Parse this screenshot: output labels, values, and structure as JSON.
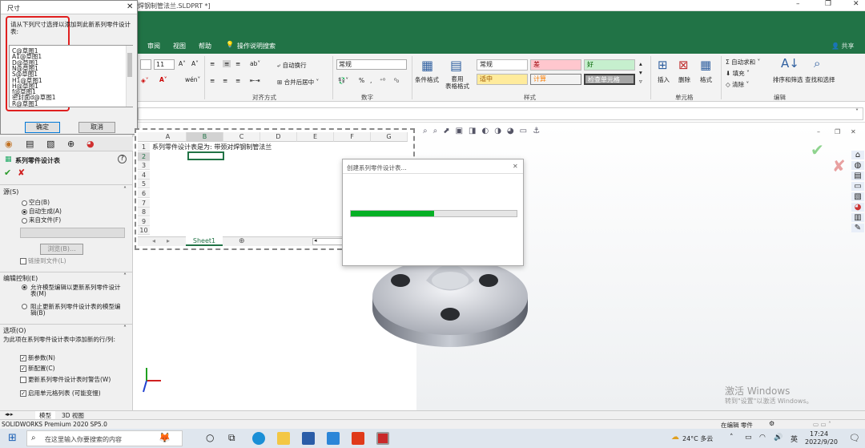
{
  "window": {
    "title": "法兰对焊钢制管法兰.SLDPRT *]",
    "title_display": "焊钢制管法兰.SLDPRT *]",
    "minimize": "–",
    "restore": "❐",
    "close": "✕"
  },
  "ribbon_tabs": [
    "审阅",
    "视图",
    "帮助",
    "操作说明搜索"
  ],
  "share_label": "共享",
  "ribbon": {
    "font_size": "11",
    "font_grow": "A˄",
    "font_shrink": "A˅",
    "wrap_text": "自动换行",
    "merge_center": "合并后居中",
    "number_format": "常规",
    "percent": "%",
    "comma": ",",
    "cond_format": "条件格式",
    "table_format": "套用\n表格格式",
    "styles": {
      "normal": "常规",
      "bad": "差",
      "good": "好",
      "neutral": "适中",
      "calc": "计算",
      "check": "检查单元格"
    },
    "insert": "插入",
    "delete": "删除",
    "format": "格式",
    "autosum": "自动求和",
    "fill": "填充",
    "clear": "清除",
    "sort_filter": "排序和筛选",
    "find_select": "查找和选择",
    "groups": {
      "alignment": "对齐方式",
      "number": "数字",
      "styles": "样式",
      "cells": "单元格",
      "editing": "编辑"
    }
  },
  "dimension_dialog": {
    "title": "尺寸",
    "prompt": "请从下列尺寸选择以添加到此新系列零件设计表:",
    "items": [
      "C@草图1",
      "A1@草图1",
      "D@草图1",
      "N@草图1",
      "S@草图1",
      "H1@草图1",
      "H@草图1",
      "f@草图1",
      "密封面d@草图1",
      "R@草图1"
    ],
    "ok": "确定",
    "cancel": "取消"
  },
  "property_panel": {
    "title": "系列零件设计表",
    "help": "?",
    "source_section": "源(S)",
    "source_options": [
      "空白(B)",
      "自动生成(A)",
      "来自文件(F)"
    ],
    "source_selected": 1,
    "browse": "浏览(B)...",
    "link_file": "链接到文件(L)",
    "edit_section": "编辑控制(E)",
    "edit_options": [
      "允许模型编辑以更新系列零件设计表(M)",
      "阻止更新系列零件设计表的模型编辑(B)"
    ],
    "edit_selected": 0,
    "options_section": "选项(O)",
    "options_desc": "为此项在系列零件设计表中添加新的行/列:",
    "checks": [
      {
        "label": "新参数(N)",
        "checked": true
      },
      {
        "label": "新配置(C)",
        "checked": true
      },
      {
        "label": "更新系列零件设计表时警告(W)",
        "checked": false
      },
      {
        "label": "启用单元格列表 (可能变慢)",
        "checked": true
      }
    ]
  },
  "spreadsheet": {
    "columns": [
      "A",
      "B",
      "C",
      "D",
      "E",
      "F",
      "G"
    ],
    "rows": [
      "1",
      "2",
      "3",
      "4",
      "5",
      "6",
      "7",
      "8",
      "9",
      "10"
    ],
    "cell_a1": "系列零件设计表是为:  带颈对焊钢制管法兰",
    "sheet_tab": "Sheet1"
  },
  "progress_dialog": {
    "title": "创建系列零件设计表...",
    "progress": 0.5
  },
  "bottom_tabs": [
    "模型",
    "3D 视图"
  ],
  "status": {
    "app": "SOLIDWORKS Premium 2020 SP5.0",
    "editing": "在编辑 零件"
  },
  "watermark": {
    "line1": "激活 Windows",
    "line2": "转到\"设置\"以激活 Windows。"
  },
  "taskbar": {
    "search_placeholder": "在这里输入你要搜索的内容",
    "weather": "24°C 多云",
    "lang": "英",
    "time": "17:24",
    "date": "2022/9/20"
  },
  "colors": {
    "excel_green": "#217346",
    "progress_green": "#06b025",
    "bad_bg": "#ffc7ce",
    "good_bg": "#c6efce",
    "neutral_bg": "#ffeb9c"
  }
}
